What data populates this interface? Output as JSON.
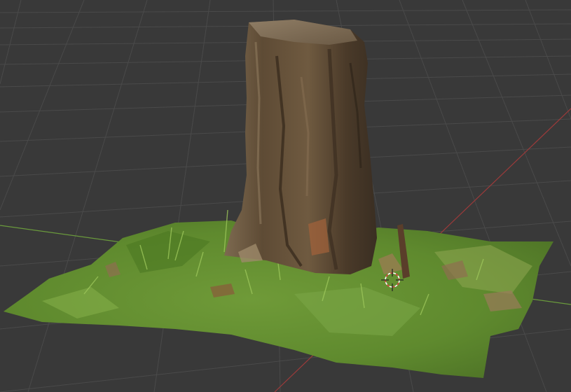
{
  "viewport": {
    "background_color": "#393939",
    "grid_line_color": "#4a4a4a",
    "x_axis_color": "#9c3a3a",
    "y_axis_color": "#6a9a3c",
    "cursor_icon": "3d-cursor-icon",
    "object_icon": "tree-stump-icon",
    "ground_icon": "grass-ground-icon"
  }
}
